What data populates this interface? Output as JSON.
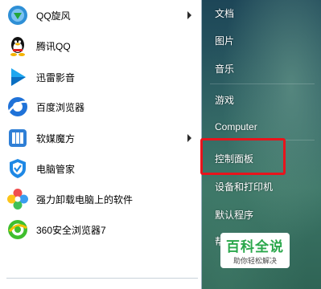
{
  "programs": [
    {
      "label": "QQ旋风",
      "icon": "qq-whirlwind-icon",
      "has_submenu": true
    },
    {
      "label": "腾讯QQ",
      "icon": "qq-penguin-icon",
      "has_submenu": false
    },
    {
      "label": "迅雷影音",
      "icon": "xunlei-player-icon",
      "has_submenu": false
    },
    {
      "label": "百度浏览器",
      "icon": "baidu-browser-icon",
      "has_submenu": false
    },
    {
      "label": "软媒魔方",
      "icon": "ruanmei-cube-icon",
      "has_submenu": true
    },
    {
      "label": "电脑管家",
      "icon": "pc-manager-shield-icon",
      "has_submenu": false
    },
    {
      "label": "强力卸载电脑上的软件",
      "icon": "uninstall-flower-icon",
      "has_submenu": false
    },
    {
      "label": "360安全浏览器7",
      "icon": "360-browser-icon",
      "has_submenu": false
    }
  ],
  "places": [
    {
      "label": "文档"
    },
    {
      "label": "图片"
    },
    {
      "label": "音乐"
    },
    {
      "label": "游戏"
    },
    {
      "label": "Computer"
    },
    {
      "label": "控制面板"
    },
    {
      "label": "设备和打印机"
    },
    {
      "label": "默认程序"
    },
    {
      "label": "帮"
    }
  ],
  "highlight_color": "#e8141c",
  "watermark": {
    "title": "百科全说",
    "subtitle": "助你轻松解决"
  }
}
